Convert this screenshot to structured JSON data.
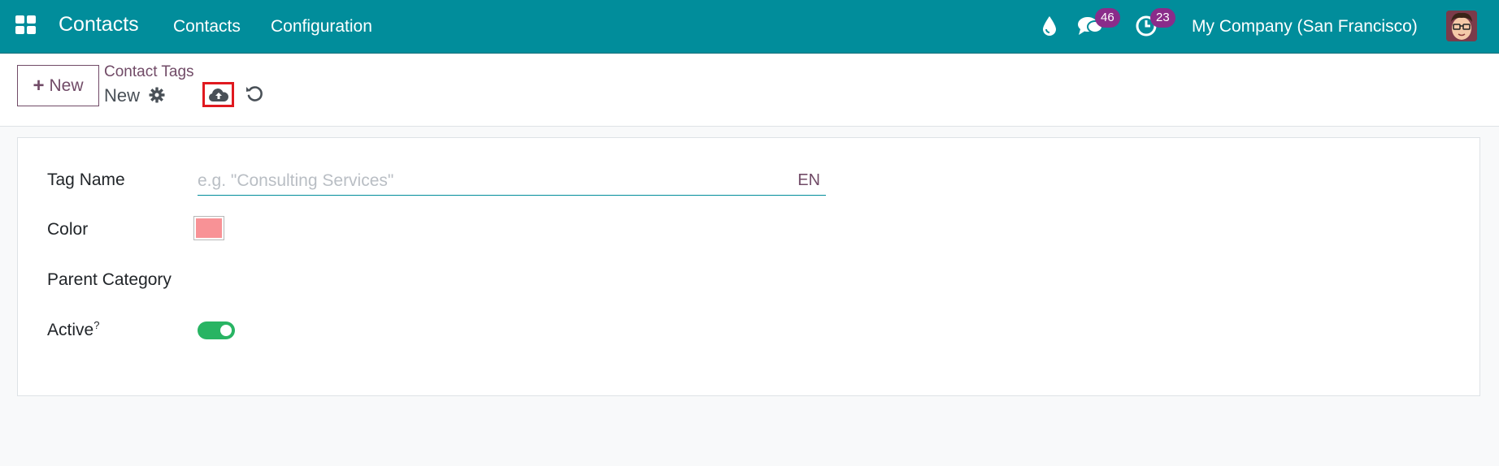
{
  "navbar": {
    "app_title": "Contacts",
    "menus": [
      "Contacts",
      "Configuration"
    ],
    "messages_count": "46",
    "activities_count": "23",
    "company": "My Company (San Francisco)"
  },
  "control_panel": {
    "new_label": "New",
    "breadcrumb": "Contact Tags",
    "record_name": "New"
  },
  "form": {
    "tag_name_label": "Tag Name",
    "tag_name_placeholder": "e.g. \"Consulting Services\"",
    "tag_name_value": "",
    "lang": "EN",
    "color_label": "Color",
    "color_value": "#f89296",
    "parent_category_label": "Parent Category",
    "active_label": "Active",
    "active_help": "?",
    "active_value": true
  },
  "colors": {
    "navbar": "#018d9b",
    "brand": "#714b67",
    "badge": "#8a2c8a",
    "toggle_on": "#28b463",
    "highlight": "#e0191f"
  },
  "icons": [
    "apps-grid-icon",
    "water-drop-icon",
    "chat-bubbles-icon",
    "clock-icon",
    "gear-icon",
    "cloud-upload-icon",
    "undo-icon",
    "plus-icon"
  ]
}
